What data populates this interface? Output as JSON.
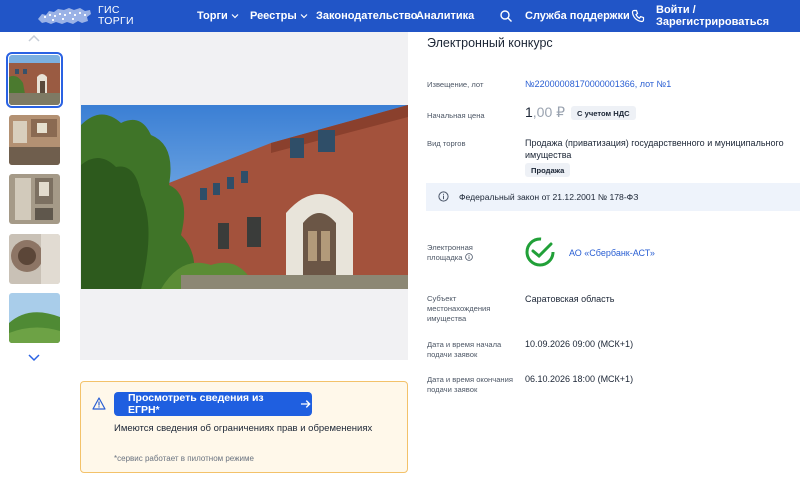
{
  "header": {
    "logo_line1": "ГИС",
    "logo_line2": "ТОРГИ",
    "nav": [
      {
        "label": "Торги"
      },
      {
        "label": "Реестры"
      },
      {
        "label": "Законодательство"
      },
      {
        "label": "Аналитика"
      }
    ],
    "support_label": "Служба поддержки",
    "login_label": "Войти / Зарегистрироваться",
    "icons": [
      "search-icon",
      "phone-icon"
    ]
  },
  "gallery": {
    "thumbnail_count": 5,
    "active_index": 0
  },
  "egrn": {
    "button_label": "Просмотреть сведения из ЕГРН*",
    "text": "Имеются сведения об ограничениях прав и обременениях",
    "note": "*сервис работает в пилотном режиме"
  },
  "lot": {
    "title": "Электронный конкурс",
    "notice_label": "Извещение, лот",
    "notice_value": "№22000008170000001366, лот №1",
    "price_label": "Начальная цена",
    "price_main": "1",
    "price_rest": ",00 ₽",
    "price_badge": "С учетом НДС",
    "type_label": "Вид торгов",
    "type_value_line1": "Продажа (приватизация) государственного и муниципального",
    "type_value_line2": "имущества",
    "type_badge": "Продажа",
    "law": "Федеральный закон от 21.12.2001 № 178-ФЗ",
    "platform_label_line1": "Электронная",
    "platform_label_line2": "площадка",
    "platform_value": "АО «Сбербанк-АСТ»",
    "location_label_line1": "Субъект",
    "location_label_line2": "местонахождения",
    "location_label_line3": "имущества",
    "location_value": "Саратовская область",
    "start_label_line1": "Дата и время начала",
    "start_label_line2": "подачи заявок",
    "start_value": "10.09.2026 09:00 (МСК+1)",
    "end_label_line1": "Дата и время окончания",
    "end_label_line2": "подачи заявок",
    "end_value": "06.10.2026 18:00 (МСК+1)"
  },
  "colors": {
    "header_bg": "#2155c7",
    "primary_button": "#1f5fe0",
    "link": "#2a5fd3",
    "notice_bg": "#fff8ea",
    "notice_border": "#f3c26a",
    "law_bg": "#eef3fb",
    "sber_green": "#21a038"
  }
}
